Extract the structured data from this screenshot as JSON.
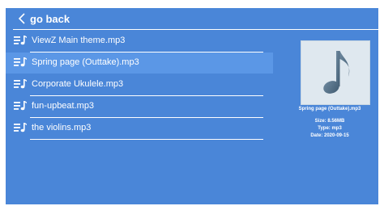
{
  "header": {
    "back_label": "go back"
  },
  "files": [
    {
      "name": "ViewZ Main theme.mp3"
    },
    {
      "name": "Spring page (Outtake).mp3",
      "selected": true
    },
    {
      "name": "Corporate Ukulele.mp3"
    },
    {
      "name": "fun-upbeat.mp3"
    },
    {
      "name": "the violins.mp3"
    }
  ],
  "details": {
    "file_name": "Spring page (Outtake).mp3",
    "size": "Size:  8.56MB",
    "type": "Type:  mp3",
    "date": "Date:  2020-09-15"
  },
  "colors": {
    "background": "#4a86d8",
    "selected_row": "#5b97e6",
    "text": "#ffffff"
  },
  "icons": {
    "back": "chevron-left-icon",
    "file": "music-list-icon",
    "thumbnail": "music-note-icon"
  }
}
